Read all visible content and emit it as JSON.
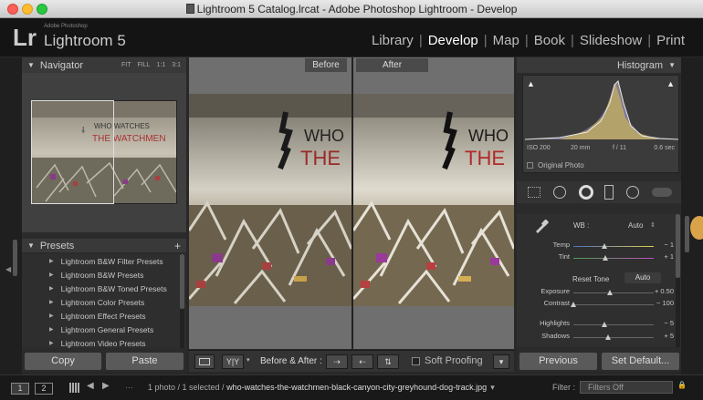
{
  "window": {
    "title": "Lightroom 5 Catalog.lrcat - Adobe Photoshop Lightroom - Develop"
  },
  "identity": {
    "logo": "Lr",
    "company": "Adobe Photoshop",
    "product": "Lightroom 5"
  },
  "modules": [
    "Library",
    "Develop",
    "Map",
    "Book",
    "Slideshow",
    "Print"
  ],
  "module_active": "Develop",
  "navigator": {
    "title": "Navigator",
    "zoom_options": [
      "FIT",
      "FILL",
      "1:1",
      "3:1"
    ]
  },
  "presets": {
    "title": "Presets",
    "add": "+",
    "items": [
      "Lightroom B&W Filter Presets",
      "Lightroom B&W Presets",
      "Lightroom B&W Toned Presets",
      "Lightroom Color Presets",
      "Lightroom Effect Presets",
      "Lightroom General Presets",
      "Lightroom Video Presets"
    ]
  },
  "left_buttons": {
    "copy": "Copy",
    "paste": "Paste"
  },
  "compare": {
    "before": "Before",
    "after": "After"
  },
  "toolbar": {
    "view_yy": "Y|Y",
    "before_after_label": "Before & After :",
    "soft_proofing": "Soft Proofing"
  },
  "histogram": {
    "title": "Histogram",
    "iso": "ISO 200",
    "focal": "20 mm",
    "aperture": "f / 11",
    "shutter": "0.6 sec",
    "original_photo": "Original Photo"
  },
  "basic": {
    "wb_label": "WB :",
    "wb_value": "Auto",
    "temp": {
      "label": "Temp",
      "value": "− 1",
      "pos": 0.5
    },
    "tint": {
      "label": "Tint",
      "value": "+ 1",
      "pos": 0.5
    },
    "reset_tone": "Reset Tone",
    "auto": "Auto",
    "exposure": {
      "label": "Exposure",
      "value": "+ 0.50",
      "pos": 0.55
    },
    "contrast": {
      "label": "Contrast",
      "value": "− 100",
      "pos": 0.0
    },
    "highlights": {
      "label": "Highlights",
      "value": "− 5",
      "pos": 0.48
    },
    "shadows": {
      "label": "Shadows",
      "value": "+ 5",
      "pos": 0.52
    }
  },
  "right_buttons": {
    "previous": "Previous",
    "set_default": "Set Default..."
  },
  "filmstrip": {
    "screen1": "1",
    "screen2": "2",
    "selection": "1 photo / 1 selected / ",
    "filename": "who-watches-the-watchmen-black-canyon-city-greyhound-dog-track.jpg",
    "filter_label": "Filter :",
    "filter_value": "Filters Off"
  },
  "colors": {
    "background": "#282828",
    "panel": "#2b2b2b",
    "active_module": "#ffffff",
    "accent_orange": "#e8a040"
  }
}
